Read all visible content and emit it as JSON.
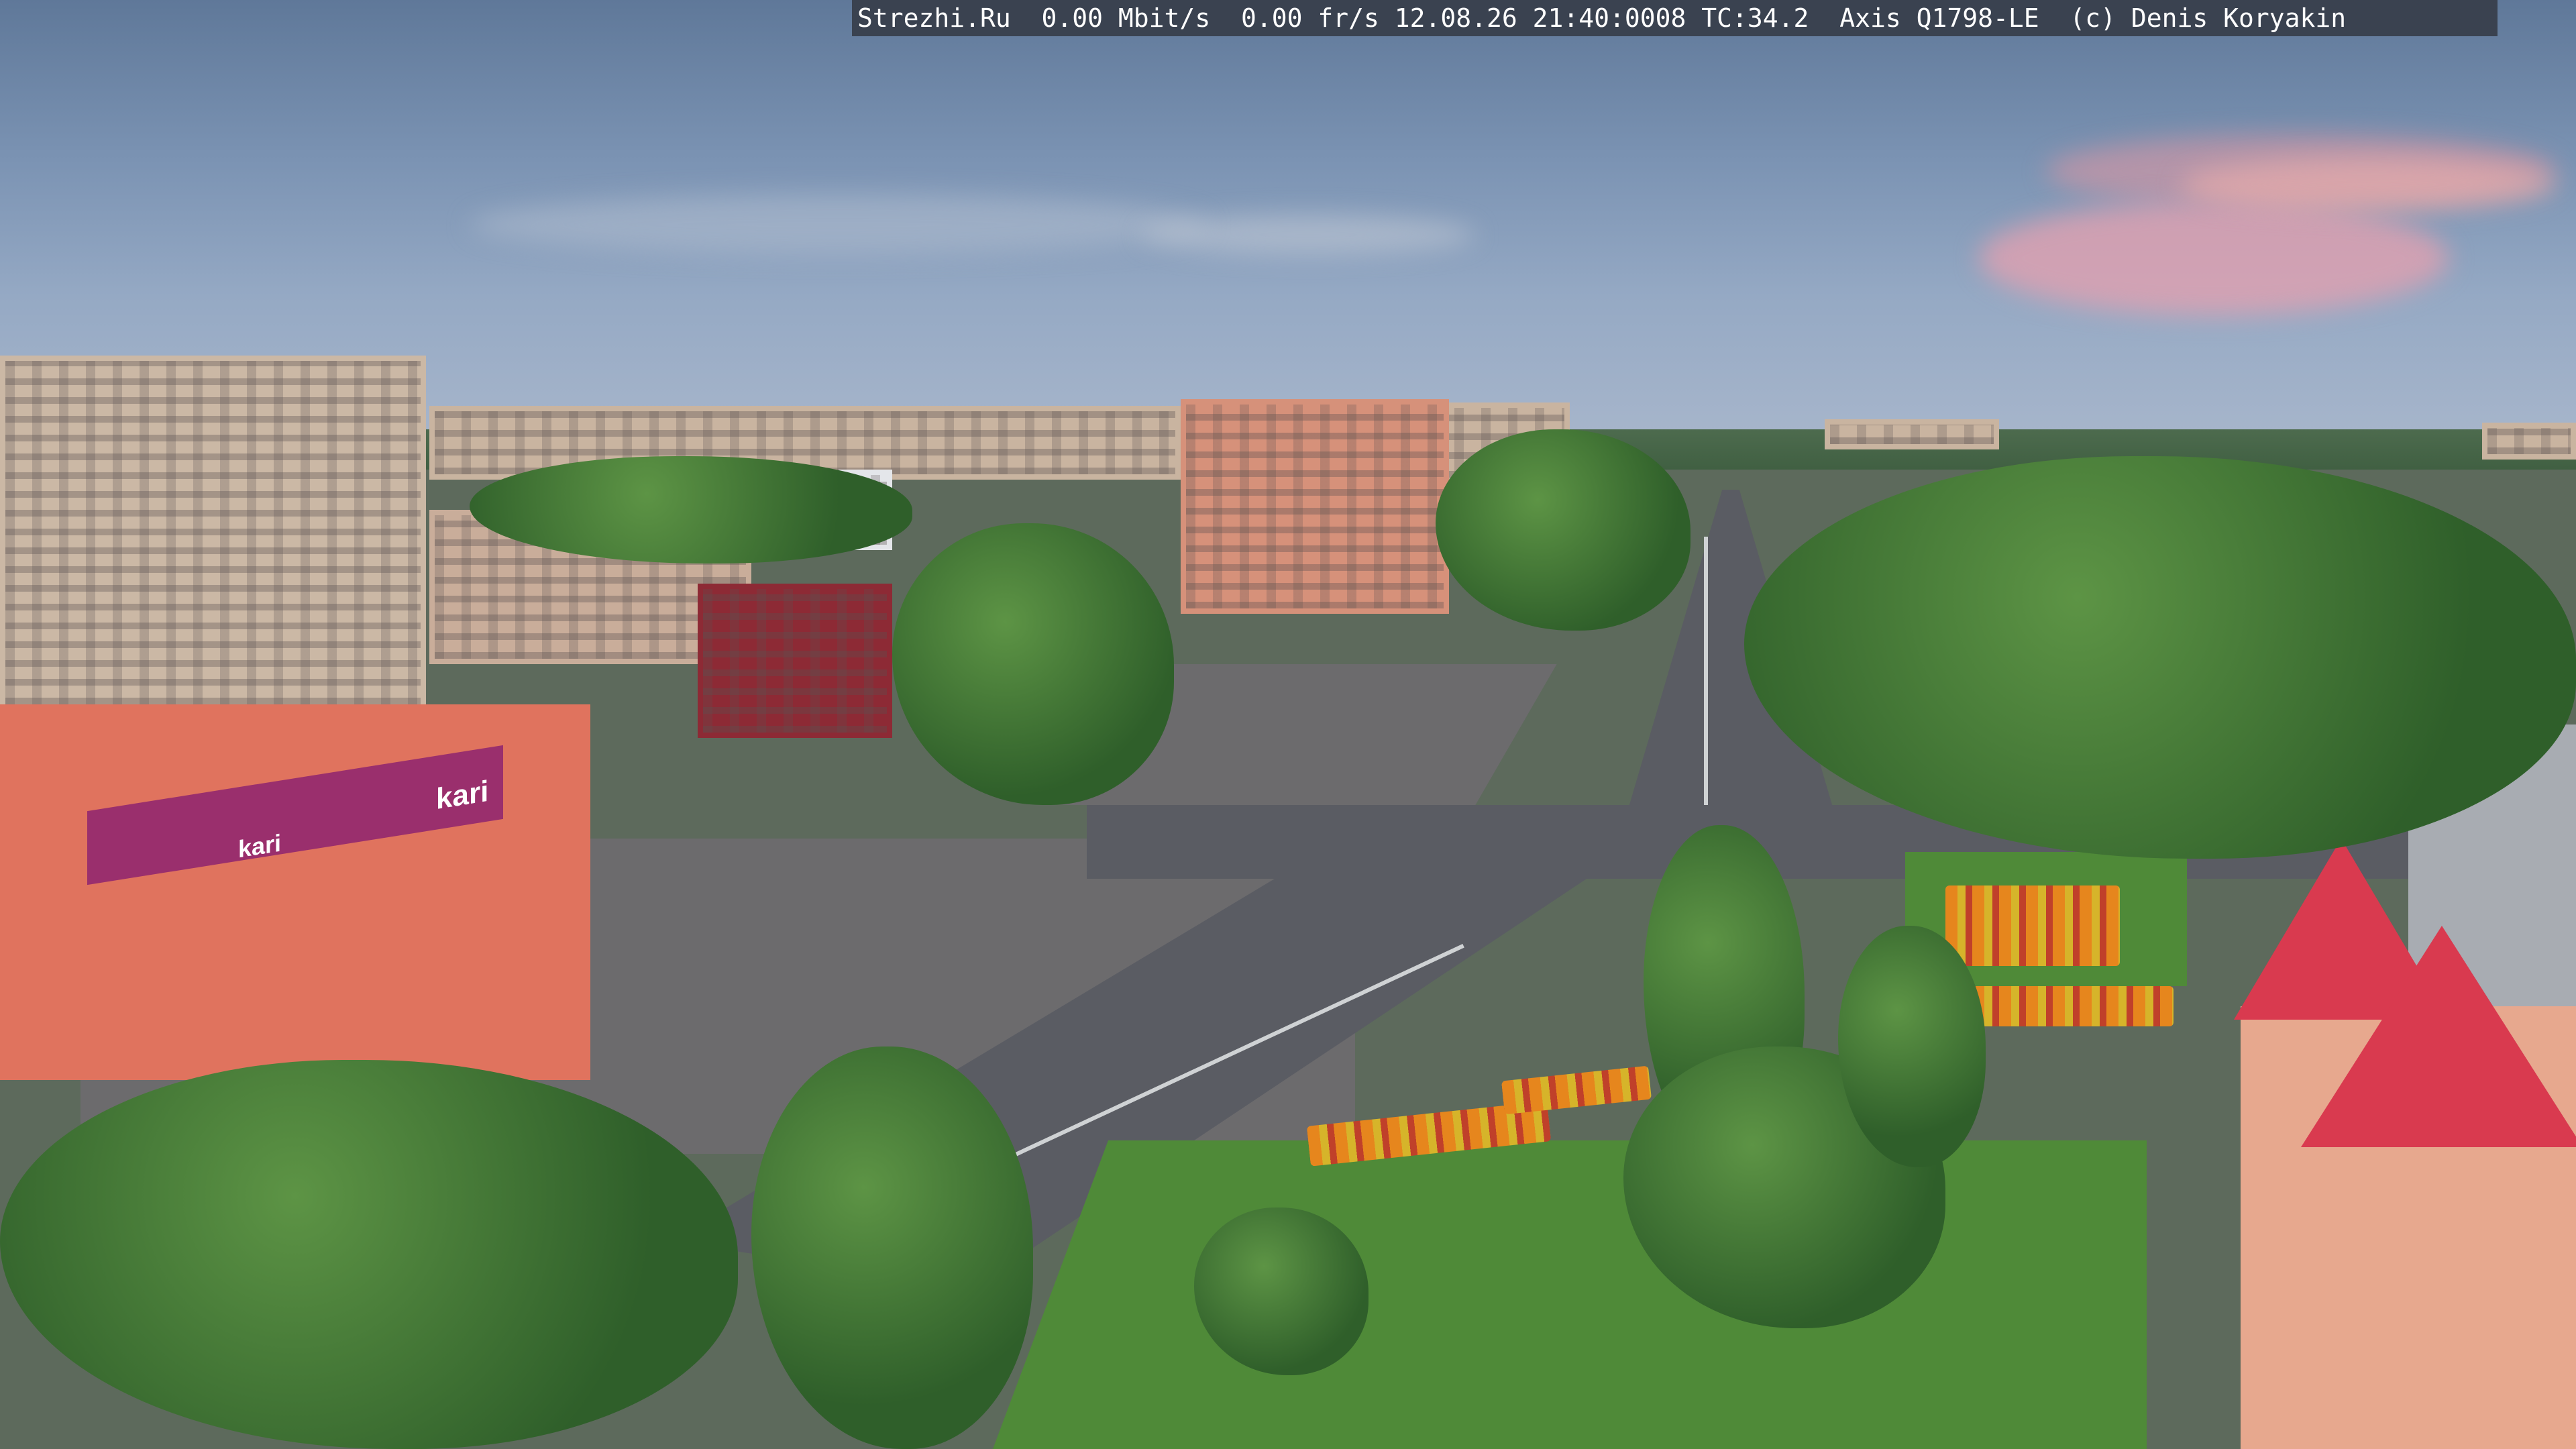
{
  "overlay": {
    "caption": "Strezhi.Ru  0.00 Mbit/s  0.00 fr/s 12.08.26 21:40:0008 TC:34.2  Axis Q1798-LE  (c) Denis Koryakin"
  },
  "scene": {
    "store_sign_text": "kari",
    "colors": {
      "sky": "#7b93b3",
      "pink_cloud": "#e6a0af",
      "foliage": "#2f5f2a",
      "roof_red": "#d93a4f",
      "store_red": "#e0735e",
      "store_banner": "#9a2f6d"
    }
  }
}
